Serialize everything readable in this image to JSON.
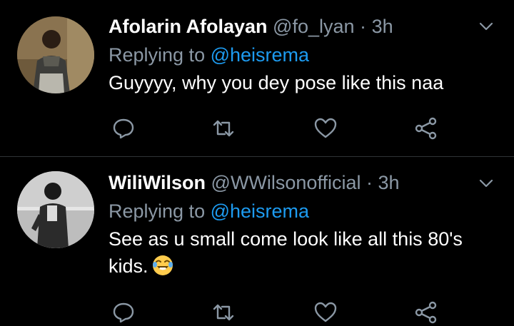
{
  "colors": {
    "background": "#000000",
    "name": "#ffffff",
    "muted": "#8b98a5",
    "mention": "#1d9bf0",
    "divider": "#2f3336"
  },
  "tweets": [
    {
      "name": "Afolarin Afolayan",
      "handle": "@fo_lyan",
      "separator": "·",
      "time": "3h",
      "replying_prefix": "Replying to",
      "replying_to": "@heisrema",
      "text": "Guyyyy, why you dey pose like this naa",
      "avatar_icon": "profile-photo",
      "menu_icon": "chevron-down-icon",
      "actions": [
        "reply-icon",
        "retweet-icon",
        "like-icon",
        "share-icon"
      ]
    },
    {
      "name": "WiliWilson",
      "handle": "@WWilsonofficial",
      "separator": "·",
      "time": "3h",
      "replying_prefix": "Replying to",
      "replying_to": "@heisrema",
      "text": "See as u small come look like all this 80's kids.",
      "emoji": "laughing-crying-emoji",
      "avatar_icon": "profile-photo",
      "menu_icon": "chevron-down-icon",
      "actions": [
        "reply-icon",
        "retweet-icon",
        "like-icon",
        "share-icon"
      ]
    }
  ]
}
